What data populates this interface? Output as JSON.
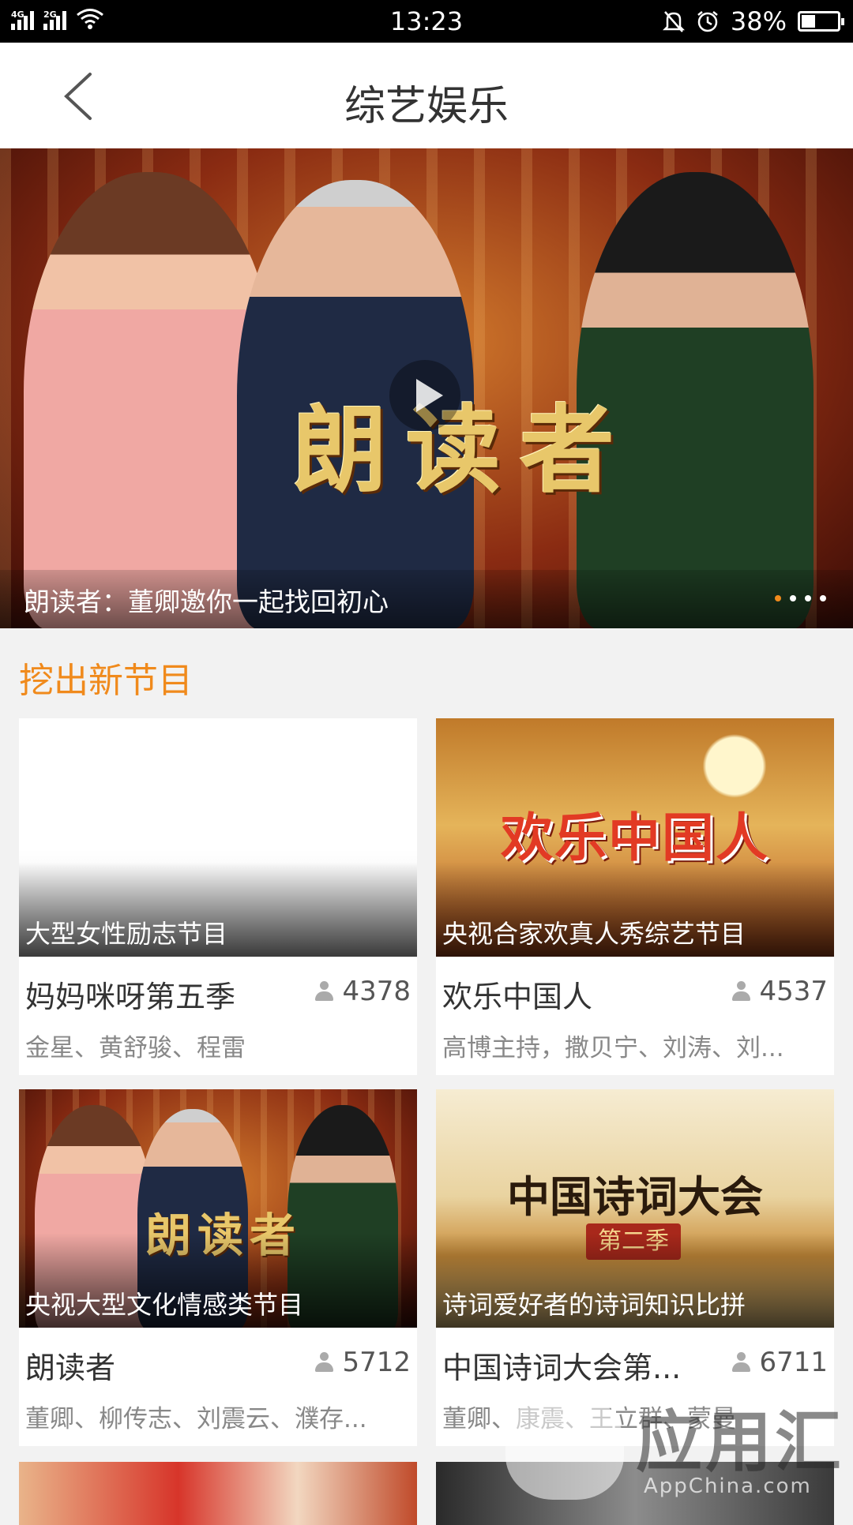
{
  "status_bar": {
    "net1": "4G",
    "net2": "2G",
    "time": "13:23",
    "battery": "38%",
    "battery_level": 0.38
  },
  "header": {
    "title": "综艺娱乐"
  },
  "banner": {
    "art_text": "朗读者",
    "caption": "朗读者：董卿邀你一起找回初心",
    "pages": 4,
    "active_page": 1
  },
  "section": {
    "title": "挖出新节目"
  },
  "cards": [
    {
      "tag": "大型女性励志节目",
      "name": "妈妈咪呀第五季",
      "count": "4378",
      "cast": "金星、黄舒骏、程雷"
    },
    {
      "tag": "央视合家欢真人秀综艺节目",
      "art": "欢乐中国人",
      "name": "欢乐中国人",
      "count": "4537",
      "cast": "高博主持，撒贝宁、刘涛、刘..."
    },
    {
      "tag": "央视大型文化情感类节目",
      "art": "朗读者",
      "name": "朗读者",
      "count": "5712",
      "cast": "董卿、柳传志、刘震云、濮存..."
    },
    {
      "tag": "诗词爱好者的诗词知识比拼",
      "art": "中国诗词大会",
      "seal": "第二季",
      "name": "中国诗词大会第...",
      "count": "6711",
      "cast": "董卿、康震、王立群、蒙曼"
    }
  ],
  "watermark": {
    "text": "应用汇",
    "sub": "AppChina.com"
  },
  "colors": {
    "accent": "#f08a1c",
    "dot_active": "#f08a1c"
  }
}
